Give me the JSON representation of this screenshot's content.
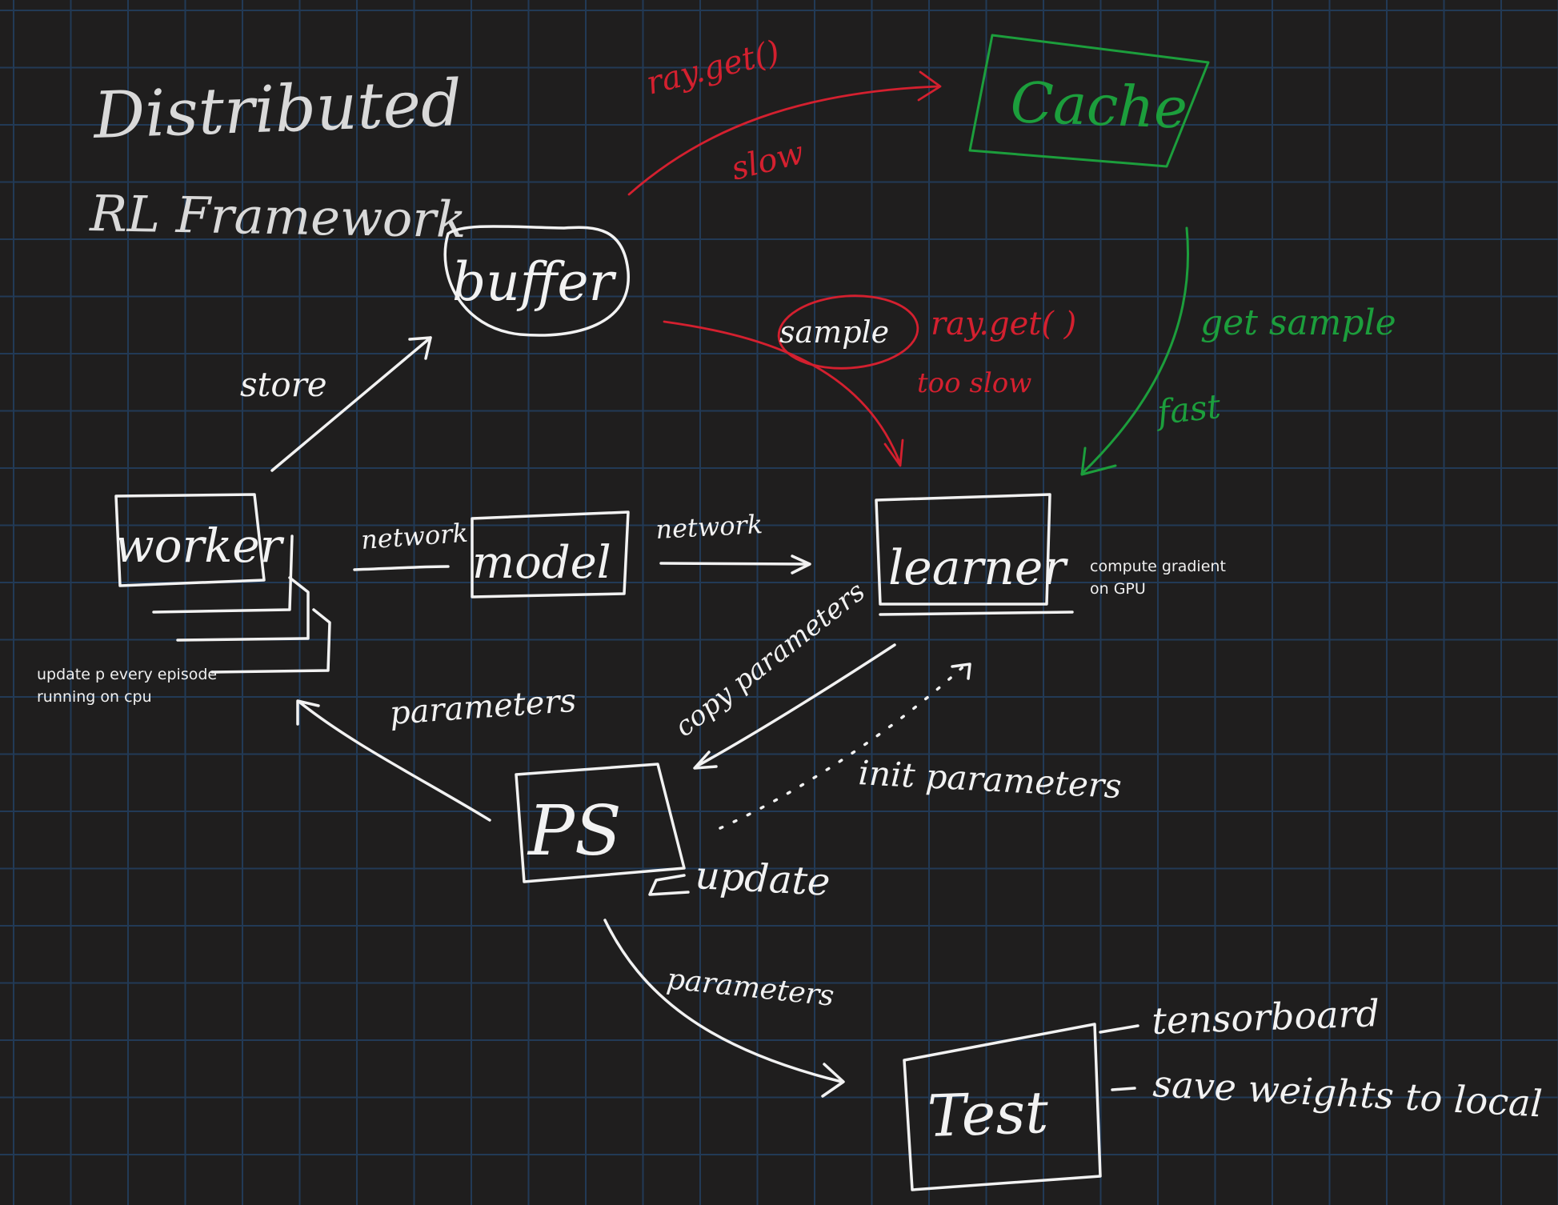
{
  "title": {
    "line1": "Distributed",
    "line2": "RL Framework"
  },
  "nodes": {
    "buffer": "buffer",
    "cache": "Cache",
    "sample": "sample",
    "worker": "worker",
    "model": "model",
    "learner": "learner",
    "ps": "PS",
    "test": "Test"
  },
  "edge_labels": {
    "ray_get_top": "ray.get()",
    "slow": "slow",
    "ray_get_mid": "ray.get( )",
    "too_slow": "too slow",
    "get_sample": "get sample",
    "fast": "fast",
    "store": "store",
    "network_left": "network",
    "network_right": "network",
    "copy_parameters": "copy parameters",
    "init_parameters": "init parameters",
    "parameters_worker": "parameters",
    "update": "update",
    "parameters_test": "parameters",
    "tensorboard": "tensorboard",
    "save_weights": "save weights to local"
  },
  "notes": {
    "learner_line1": "compute gradient",
    "learner_line2": "on GPU",
    "worker_line1": "update p every episode",
    "worker_line2": "running on cpu"
  },
  "colors": {
    "background": "#1f1e1e",
    "grid": "#223a56",
    "ink_white": "#f2f2f2",
    "ink_red": "#d4202f",
    "ink_green": "#1c9e3c"
  }
}
